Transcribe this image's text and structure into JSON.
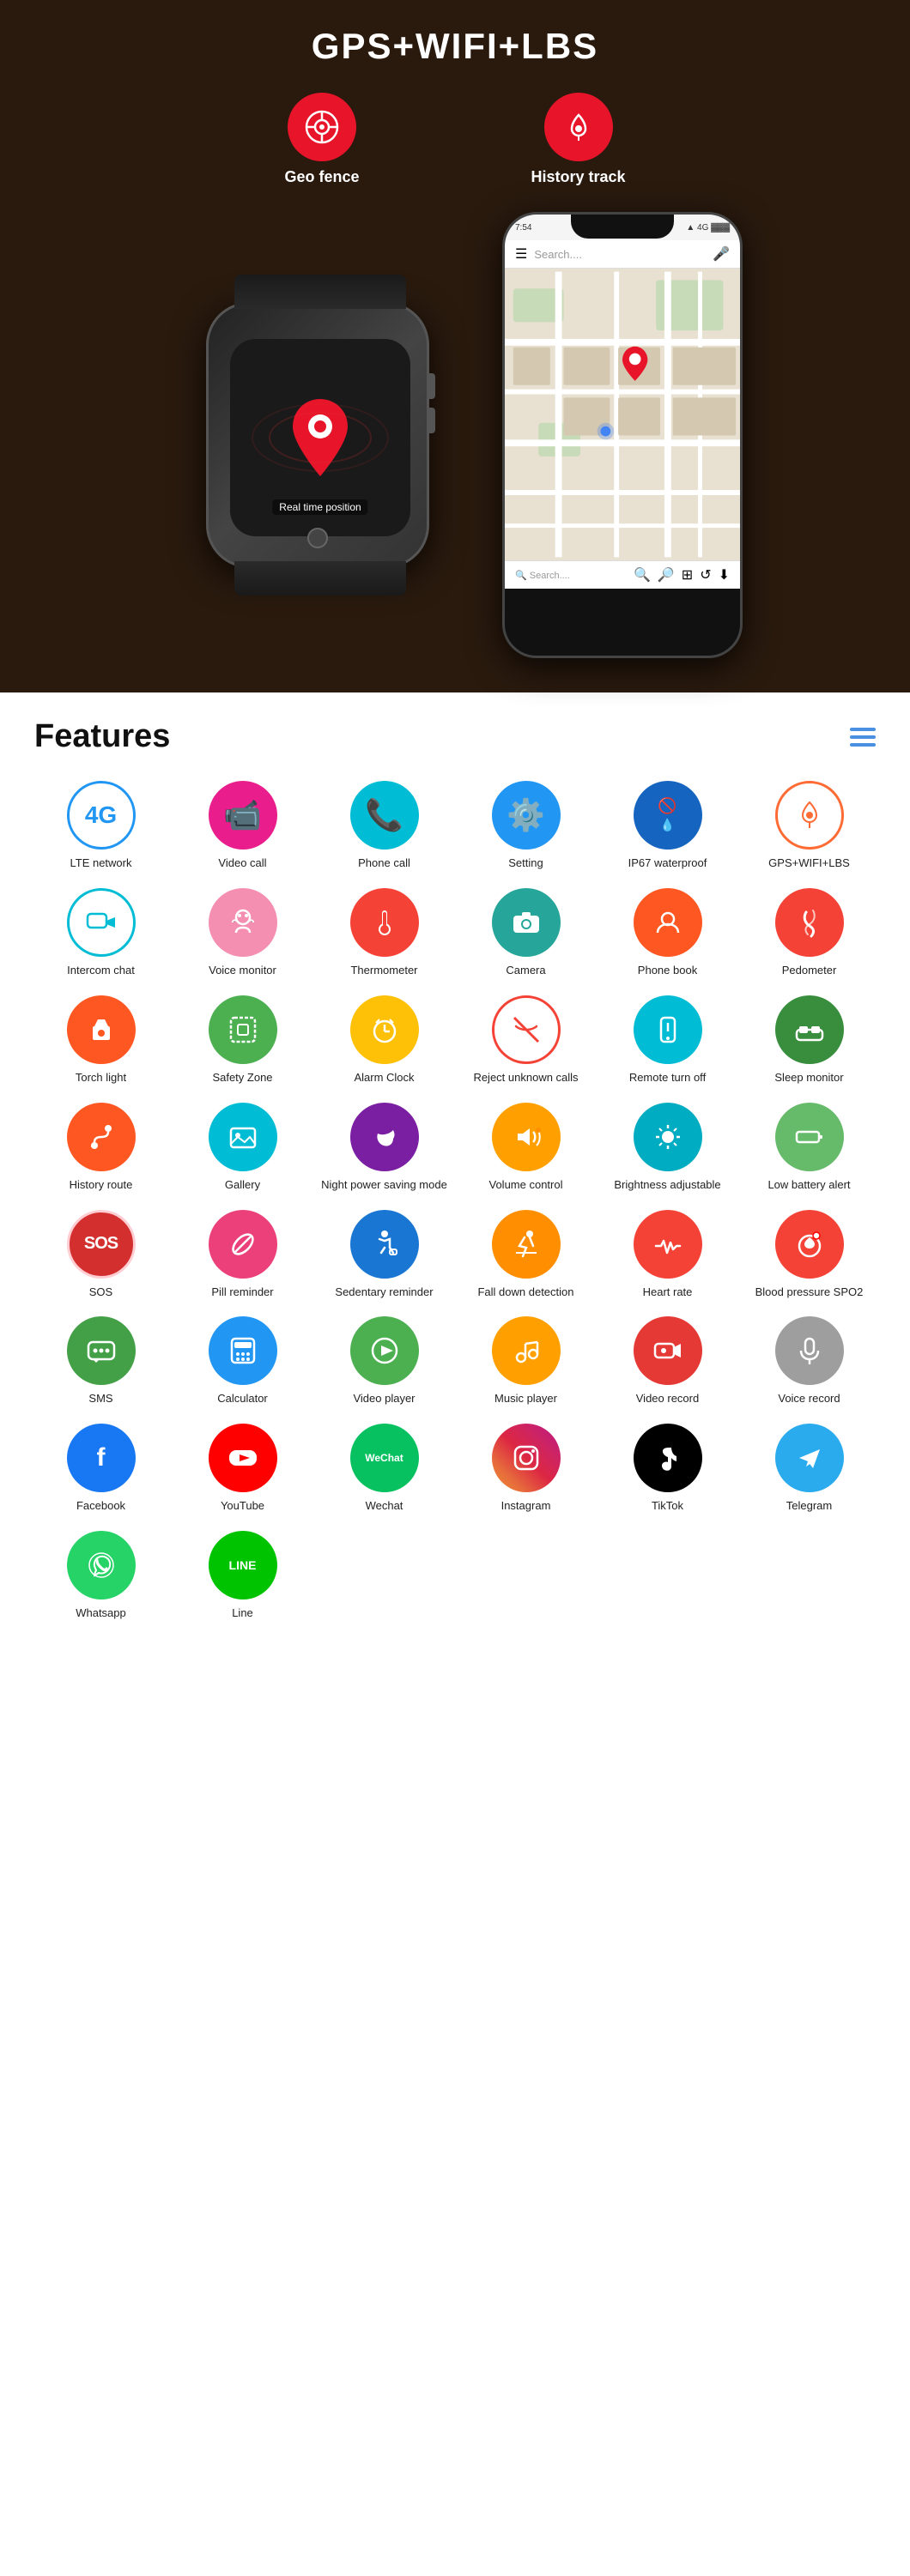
{
  "hero": {
    "title": "GPS+WIFI+LBS",
    "geo_fence_label": "Geo fence",
    "history_track_label": "History track",
    "real_time_label": "Real time position",
    "phone_search_placeholder": "Search....",
    "phone_time": "7:54",
    "phone_signal": "4G"
  },
  "features": {
    "title": "Features",
    "items": [
      {
        "id": "lte",
        "label": "LTE network",
        "icon": "4G",
        "color": "ic-blue-outline"
      },
      {
        "id": "video-call",
        "label": "Video call",
        "icon": "📹",
        "color": "ic-pink"
      },
      {
        "id": "phone-call",
        "label": "Phone call",
        "icon": "📞",
        "color": "ic-teal"
      },
      {
        "id": "setting",
        "label": "Setting",
        "icon": "⚙️",
        "color": "ic-blue"
      },
      {
        "id": "ip67",
        "label": "IP67 waterproof",
        "icon": "🚫💧",
        "color": "ic-blue-dark"
      },
      {
        "id": "gps",
        "label": "GPS+WIFI+LBS",
        "icon": "📍",
        "color": "ic-orange-outline"
      },
      {
        "id": "intercom",
        "label": "Intercom chat",
        "icon": "💬",
        "color": "ic-teal-outline"
      },
      {
        "id": "voice-monitor",
        "label": "Voice monitor",
        "icon": "🎧",
        "color": "ic-pink-bg"
      },
      {
        "id": "thermometer",
        "label": "Thermometer",
        "icon": "🌡️",
        "color": "ic-red"
      },
      {
        "id": "camera",
        "label": "Camera",
        "icon": "📷",
        "color": "ic-teal-green"
      },
      {
        "id": "phonebook",
        "label": "Phone book",
        "icon": "👤",
        "color": "ic-orange-red"
      },
      {
        "id": "pedometer",
        "label": "Pedometer",
        "icon": "🏃",
        "color": "ic-red"
      },
      {
        "id": "torch",
        "label": "Torch light",
        "icon": "🔦",
        "color": "ic-orange-red"
      },
      {
        "id": "safety-zone",
        "label": "Safety Zone",
        "icon": "🔲",
        "color": "ic-green"
      },
      {
        "id": "alarm-clock",
        "label": "Alarm Clock",
        "icon": "⏰",
        "color": "ic-gold"
      },
      {
        "id": "reject-calls",
        "label": "Reject unknown calls",
        "icon": "📵",
        "color": "ic-red-outline"
      },
      {
        "id": "remote-off",
        "label": "Remote turn off",
        "icon": "📱",
        "color": "ic-teal"
      },
      {
        "id": "sleep",
        "label": "Sleep monitor",
        "icon": "🛏️",
        "color": "ic-green-dark"
      },
      {
        "id": "history-route",
        "label": "History route",
        "icon": "👣",
        "color": "ic-orange-red"
      },
      {
        "id": "gallery",
        "label": "Gallery",
        "icon": "🖼️",
        "color": "ic-teal"
      },
      {
        "id": "night-power",
        "label": "Night power saving mode",
        "icon": "🌙",
        "color": "ic-purple"
      },
      {
        "id": "volume",
        "label": "Volume control",
        "icon": "🔊",
        "color": "ic-amber"
      },
      {
        "id": "brightness",
        "label": "Brightness adjustable",
        "icon": "☀️",
        "color": "ic-cyan"
      },
      {
        "id": "low-battery",
        "label": "Low battery alert",
        "icon": "🔋",
        "color": "ic-green-light"
      },
      {
        "id": "sos",
        "label": "SOS",
        "icon": "SOS",
        "color": "ic-red-sos"
      },
      {
        "id": "pill",
        "label": "Pill reminder",
        "icon": "💊",
        "color": "ic-pink-med"
      },
      {
        "id": "sedentary",
        "label": "Sedentary reminder",
        "icon": "🪑",
        "color": "ic-blue-med"
      },
      {
        "id": "fall-down",
        "label": "Fall down detection",
        "icon": "🚶",
        "color": "ic-orange-amber"
      },
      {
        "id": "heart-rate",
        "label": "Heart rate",
        "icon": "💓",
        "color": "ic-red"
      },
      {
        "id": "blood-pressure",
        "label": "Blood pressure SPO2",
        "icon": "🩺",
        "color": "ic-red"
      },
      {
        "id": "sms",
        "label": "SMS",
        "icon": "💬",
        "color": "ic-green-chat"
      },
      {
        "id": "calculator",
        "label": "Calculator",
        "icon": "🧮",
        "color": "ic-blue"
      },
      {
        "id": "video-player",
        "label": "Video player",
        "icon": "▶️",
        "color": "ic-green"
      },
      {
        "id": "music-player",
        "label": "Music player",
        "icon": "🎵",
        "color": "ic-amber"
      },
      {
        "id": "video-record",
        "label": "Video record",
        "icon": "🎥",
        "color": "ic-red-vid"
      },
      {
        "id": "voice-record",
        "label": "Voice record",
        "icon": "🎙️",
        "color": "ic-grey"
      },
      {
        "id": "facebook",
        "label": "Facebook",
        "icon": "f",
        "color": "ic-facebook"
      },
      {
        "id": "youtube",
        "label": "YouTube",
        "icon": "▶",
        "color": "ic-youtube"
      },
      {
        "id": "wechat",
        "label": "Wechat",
        "icon": "WeChat",
        "color": "ic-wechat"
      },
      {
        "id": "instagram",
        "label": "Instagram",
        "icon": "📸",
        "color": "ic-instagram"
      },
      {
        "id": "tiktok",
        "label": "TikTok",
        "icon": "♪",
        "color": "ic-tiktok"
      },
      {
        "id": "telegram",
        "label": "Telegram",
        "icon": "✈",
        "color": "ic-telegram"
      },
      {
        "id": "whatsapp",
        "label": "Whatsapp",
        "icon": "📱",
        "color": "ic-whatsapp"
      },
      {
        "id": "line",
        "label": "Line",
        "icon": "LINE",
        "color": "ic-line"
      }
    ]
  }
}
